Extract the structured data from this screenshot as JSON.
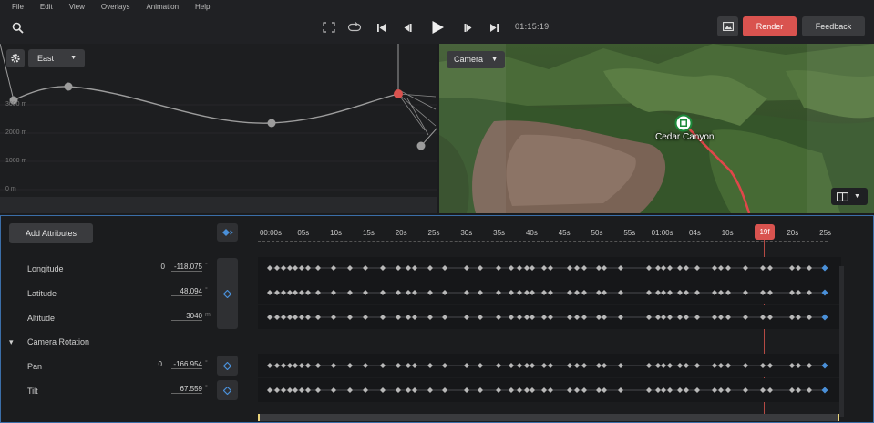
{
  "menu": [
    "File",
    "Edit",
    "View",
    "Overlays",
    "Animation",
    "Help"
  ],
  "toolbar": {
    "timecode": "01:15:19",
    "render_label": "Render",
    "feedback_label": "Feedback"
  },
  "graph": {
    "direction": "East",
    "altitude_ticks": [
      "3000 m",
      "2000 m",
      "1000 m",
      "0 m"
    ]
  },
  "map": {
    "view_select": "Camera",
    "location_label": "Cedar Canyon"
  },
  "timeline": {
    "add_attributes_label": "Add Attributes",
    "ruler_ticks": [
      "00:00s",
      "05s",
      "10s",
      "15s",
      "20s",
      "25s",
      "30s",
      "35s",
      "40s",
      "45s",
      "50s",
      "55s",
      "01:00s",
      "04s",
      "10s",
      "20s",
      "25s"
    ],
    "playhead_frame": "19f",
    "rows": {
      "longitude": {
        "label": "Longitude",
        "prefix": "0",
        "value": "-118.075",
        "unit": "°"
      },
      "latitude": {
        "label": "Latitude",
        "value": "48.094",
        "unit": "°"
      },
      "altitude": {
        "label": "Altitude",
        "value": "3040",
        "unit": "m"
      },
      "camera_rotation": {
        "label": "Camera Rotation"
      },
      "pan": {
        "label": "Pan",
        "prefix": "0",
        "value": "-166.954",
        "unit": "°"
      },
      "tilt": {
        "label": "Tilt",
        "value": "67.559",
        "unit": "°"
      }
    }
  },
  "colors": {
    "accent_red": "#d9534f",
    "key_blue": "#4a90d9",
    "selection_blue": "#3b6ea8"
  }
}
